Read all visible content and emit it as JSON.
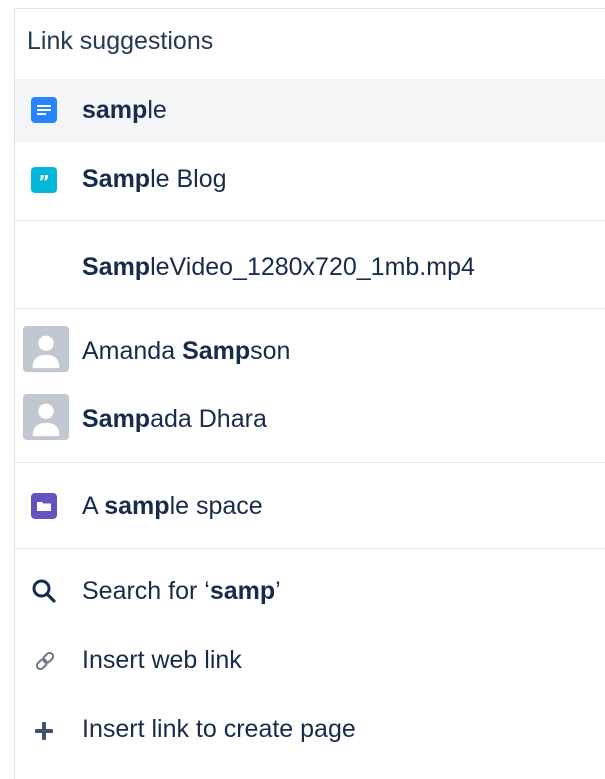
{
  "header": {
    "title": "Link suggestions"
  },
  "results": [
    {
      "parts": [
        {
          "t": "samp",
          "b": true
        },
        {
          "t": "le",
          "b": false
        }
      ],
      "icon": "page-icon",
      "color": "#2684ff"
    },
    {
      "parts": [
        {
          "t": "Samp",
          "b": true
        },
        {
          "t": "le Blog",
          "b": false
        }
      ],
      "icon": "blog-quote-icon",
      "color": "#00b8d9"
    },
    {
      "parts": [
        {
          "t": "Samp",
          "b": true
        },
        {
          "t": "leVideo_1280x720_1mb.mp4",
          "b": false
        }
      ],
      "icon": ""
    },
    {
      "parts": [
        {
          "t": "Amanda ",
          "b": false
        },
        {
          "t": "Samp",
          "b": true
        },
        {
          "t": "son",
          "b": false
        }
      ],
      "icon": "user-avatar-icon"
    },
    {
      "parts": [
        {
          "t": "Samp",
          "b": true
        },
        {
          "t": "ada Dhara",
          "b": false
        }
      ],
      "icon": "user-avatar-icon"
    },
    {
      "parts": [
        {
          "t": "A ",
          "b": false
        },
        {
          "t": "samp",
          "b": true
        },
        {
          "t": "le space",
          "b": false
        }
      ],
      "icon": "space-folder-icon",
      "color": "#6554c0"
    }
  ],
  "actions": [
    {
      "parts": [
        {
          "t": "Search for ‘",
          "b": false
        },
        {
          "t": "samp",
          "b": true
        },
        {
          "t": "’",
          "b": false
        }
      ],
      "icon": "search-icon"
    },
    {
      "parts": [
        {
          "t": "Insert web link",
          "b": false
        }
      ],
      "icon": "link-icon"
    },
    {
      "parts": [
        {
          "t": "Insert link to create page",
          "b": false
        }
      ],
      "icon": "plus-icon"
    }
  ]
}
